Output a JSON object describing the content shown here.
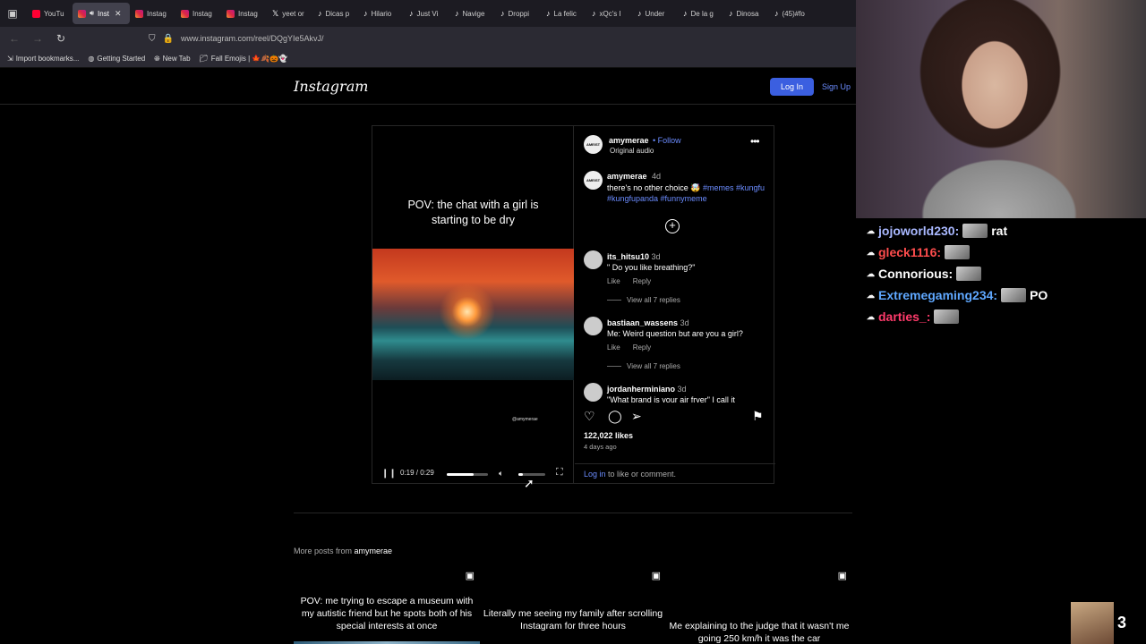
{
  "browser": {
    "tabs": [
      {
        "label": "YouTu",
        "icon": "youtube",
        "active": false
      },
      {
        "label": "Inst",
        "icon": "instagram",
        "active": true
      },
      {
        "label": "Instag",
        "icon": "instagram",
        "active": false
      },
      {
        "label": "Instag",
        "icon": "instagram",
        "active": false
      },
      {
        "label": "Instag",
        "icon": "instagram",
        "active": false
      },
      {
        "label": "yeet or",
        "icon": "x",
        "active": false
      },
      {
        "label": "Dicas p",
        "icon": "tiktok",
        "active": false
      },
      {
        "label": "Hilario",
        "icon": "tiktok",
        "active": false
      },
      {
        "label": "Just Vi",
        "icon": "tiktok",
        "active": false
      },
      {
        "label": "Navige",
        "icon": "tiktok",
        "active": false
      },
      {
        "label": "Droppi",
        "icon": "tiktok",
        "active": false
      },
      {
        "label": "La felic",
        "icon": "tiktok",
        "active": false
      },
      {
        "label": "xQc's I",
        "icon": "tiktok",
        "active": false
      },
      {
        "label": "Under",
        "icon": "tiktok",
        "active": false
      },
      {
        "label": "De la g",
        "icon": "tiktok",
        "active": false
      },
      {
        "label": "Dinosa",
        "icon": "tiktok",
        "active": false
      },
      {
        "label": "(45)#fo",
        "icon": "tiktok",
        "active": false
      }
    ],
    "url": "www.instagram.com/reel/DQgYIe5AkvJ/",
    "bookmarks": [
      {
        "label": "Import bookmarks...",
        "icon": "import-icon"
      },
      {
        "label": "Getting Started",
        "icon": "firefox-icon"
      },
      {
        "label": "New Tab",
        "icon": "globe-icon"
      },
      {
        "label": "Fall Emojis | 🍁🍂🎃👻",
        "icon": "folder-icon"
      }
    ]
  },
  "instagram": {
    "logo": "Instagram",
    "login_label": "Log In",
    "signup_label": "Sign Up",
    "video": {
      "caption": "POV: the chat with a girl is starting to be dry",
      "watermark": "@amymerae",
      "time": "0:19 / 0:29",
      "progress": 0.66,
      "volume": 0.15
    },
    "author": {
      "name": "amymerae",
      "follow": "• Follow",
      "audio": "Original audio",
      "avatar_text": "AMEIST"
    },
    "caption": {
      "user": "amymerae",
      "time": "4d",
      "text": "there's no other choice 🤯 ",
      "tags": "#memes #kungfu #kungfupanda #funnymeme"
    },
    "comments": [
      {
        "user": "its_hitsu10",
        "time": "3d",
        "text": "\" Do you like breathing?\"",
        "like": "Like",
        "reply": "Reply",
        "replies": "View all 7 replies"
      },
      {
        "user": "bastiaan_wassens",
        "time": "3d",
        "text": "Me: Weird question but are you a girl?",
        "like": "Like",
        "reply": "Reply",
        "replies": "View all 7 replies"
      },
      {
        "user": "jordanherminiano",
        "time": "3d",
        "text": "\"What brand is your air fryer\" I call it"
      }
    ],
    "likes": "122,022 likes",
    "posted": "4 days ago",
    "login_prompt_link": "Log in",
    "login_prompt_rest": " to like or comment.",
    "more_posts_prefix": "More posts from ",
    "more_posts_user": "amymerae",
    "more_posts": [
      {
        "caption": "POV: me trying to escape a museum with my autistic friend but he spots both of his special interests at once"
      },
      {
        "caption": "Literally me seeing my family after scrolling Instagram for three hours"
      },
      {
        "caption": "Me explaining to the judge that it wasn't me going 250 km/h it was the car"
      }
    ]
  },
  "stream": {
    "chat": [
      {
        "user": "jojoworld230:",
        "color": "#a9b8ff",
        "message": "rat"
      },
      {
        "user": "gleck1116:",
        "color": "#ff4d4d",
        "message": ""
      },
      {
        "user": "Connorious:",
        "color": "#ffffff",
        "message": ""
      },
      {
        "user": "Extremegaming234:",
        "color": "#5fa8ff",
        "message": "PO"
      },
      {
        "user": "darties_:",
        "color": "#ff3b6b",
        "message": ""
      }
    ],
    "viewer_count": "3"
  }
}
